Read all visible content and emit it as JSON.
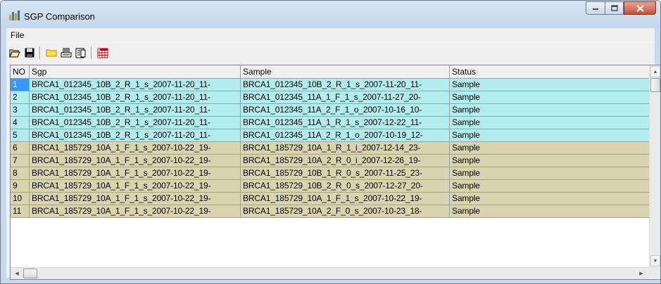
{
  "window": {
    "title": "SGP Comparison"
  },
  "menu": {
    "file_label": "File"
  },
  "toolbar": {
    "buttons": [
      {
        "name": "open-folder-icon"
      },
      {
        "name": "save-disk-icon"
      },
      {
        "name": "folder-icon"
      },
      {
        "name": "print-icon"
      },
      {
        "name": "document-icon"
      },
      {
        "name": "grid-table-icon"
      }
    ]
  },
  "colors": {
    "group_a": "#b3ecec",
    "group_b": "#d8d4b0",
    "selected": "#3399ff"
  },
  "table": {
    "columns": [
      "NO",
      "Sgp",
      "Sample",
      "Status"
    ],
    "rows": [
      {
        "no": "1",
        "sgp": "BRCA1_012345_10B_2_R_1_s_2007-11-20_11-",
        "sample": "BRCA1_012345_10B_2_R_1_s_2007-11-20_11-",
        "status": "Sample",
        "group": "a",
        "selected": true
      },
      {
        "no": "2",
        "sgp": "BRCA1_012345_10B_2_R_1_s_2007-11-20_11-",
        "sample": "BRCA1_012345_11A_1_F_1_s_2007-11-27_20-",
        "status": "Sample",
        "group": "a"
      },
      {
        "no": "3",
        "sgp": "BRCA1_012345_10B_2_R_1_s_2007-11-20_11-",
        "sample": "BRCA1_012345_11A_2_F_1_o_2007-10-16_10-",
        "status": "Sample",
        "group": "a"
      },
      {
        "no": "4",
        "sgp": "BRCA1_012345_10B_2_R_1_s_2007-11-20_11-",
        "sample": "BRCA1_012345_11A_1_R_1_s_2007-12-22_11-",
        "status": "Sample",
        "group": "a"
      },
      {
        "no": "5",
        "sgp": "BRCA1_012345_10B_2_R_1_s_2007-11-20_11-",
        "sample": "BRCA1_012345_11A_2_R_1_o_2007-10-19_12-",
        "status": "Sample",
        "group": "a"
      },
      {
        "no": "6",
        "sgp": "BRCA1_185729_10A_1_F_1_s_2007-10-22_19-",
        "sample": "BRCA1_185729_10A_1_R_1_i_2007-12-14_23-",
        "status": "Sample",
        "group": "b"
      },
      {
        "no": "7",
        "sgp": "BRCA1_185729_10A_1_F_1_s_2007-10-22_19-",
        "sample": "BRCA1_185729_10A_2_R_0_i_2007-12-26_19-",
        "status": "Sample",
        "group": "b"
      },
      {
        "no": "8",
        "sgp": "BRCA1_185729_10A_1_F_1_s_2007-10-22_19-",
        "sample": "BRCA1_185729_10B_1_R_0_s_2007-11-25_23-",
        "status": "Sample",
        "group": "b"
      },
      {
        "no": "9",
        "sgp": "BRCA1_185729_10A_1_F_1_s_2007-10-22_19-",
        "sample": "BRCA1_185729_10B_2_R_0_s_2007-12-27_20-",
        "status": "Sample",
        "group": "b"
      },
      {
        "no": "10",
        "sgp": "BRCA1_185729_10A_1_F_1_s_2007-10-22_19-",
        "sample": "BRCA1_185729_10A_1_F_1_s_2007-10-22_19-",
        "status": "Sample",
        "group": "b"
      },
      {
        "no": "11",
        "sgp": "BRCA1_185729_10A_1_F_1_s_2007-10-22_19-",
        "sample": "BRCA1_185729_10A_2_F_0_s_2007-10-23_18-",
        "status": "Sample",
        "group": "b"
      }
    ]
  }
}
